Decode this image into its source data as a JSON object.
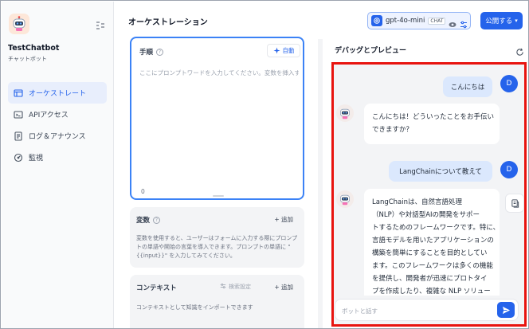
{
  "sidebar": {
    "app_name": "TestChatbot",
    "app_type": "チャットボット",
    "items": [
      {
        "label": "オーケストレート",
        "icon": "terminal-window-icon",
        "active": true
      },
      {
        "label": "APIアクセス",
        "icon": "api-terminal-icon",
        "active": false
      },
      {
        "label": "ログ＆アナウンス",
        "icon": "log-document-icon",
        "active": false
      },
      {
        "label": "監視",
        "icon": "monitor-gauge-icon",
        "active": false
      }
    ]
  },
  "header": {
    "title": "オーケストレーション",
    "model": {
      "name": "gpt-4o-mini",
      "tag": "CHAT"
    },
    "publish_label": "公開する"
  },
  "instructions": {
    "label": "手順",
    "auto_label": "自動",
    "placeholder": "ここにプロンプトワードを入力してください。変数を挿入す...",
    "char_count": "0"
  },
  "variables": {
    "label": "変数",
    "add_label": "+ 追加",
    "description": "変数を使用すると、ユーザーはフォームに入力する際にプロンプトの単語や開始の言葉を導入できます。プロンプトの単語に \"{{input}}\" を入力してみてください。"
  },
  "context": {
    "label": "コンテキスト",
    "settings_label": "検索設定",
    "add_label": "+ 追加",
    "description": "コンテキストとして知識をインポートできます"
  },
  "debug": {
    "title": "デバッグとプレビュー",
    "user_initial": "D",
    "messages": [
      {
        "role": "user",
        "text": "こんにちは"
      },
      {
        "role": "bot",
        "lines": [
          "こんにちは！どういったことをお手伝い",
          "できますか？"
        ]
      },
      {
        "role": "user",
        "text": "LangChainについて教えて"
      },
      {
        "role": "bot",
        "lines": [
          "LangChainは、自然言語処理",
          "（NLP）や対話型AIの開発をサポー",
          "トするためのフレームワークです。特に、",
          "言語モデルを用いたアプリケーションの",
          "構築を簡単にすることを目的としてい",
          "ます。このフレームワークは多くの機能",
          "を提供し、開発者が迅速にプロトタイ",
          "プを作成したり、複雑な NLP ソリュー"
        ]
      }
    ],
    "input_placeholder": "ボットと話す"
  },
  "colors": {
    "accent": "#2563eb",
    "highlight": "#e8140f",
    "user_bubble": "#dbe8fd"
  }
}
